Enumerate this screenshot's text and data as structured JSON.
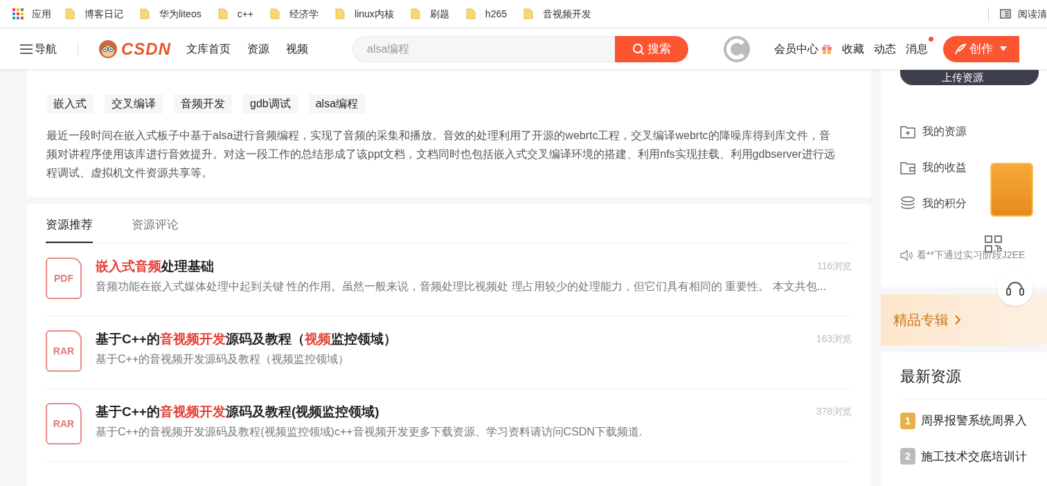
{
  "bookmarks_bar": {
    "apps_label": "应用",
    "bookmarks": [
      {
        "label": "博客日记"
      },
      {
        "label": "华为liteos"
      },
      {
        "label": "c++"
      },
      {
        "label": "经济学"
      },
      {
        "label": "linux内核"
      },
      {
        "label": "刷题"
      },
      {
        "label": "h265"
      },
      {
        "label": "音视频开发"
      }
    ],
    "reading_list": "阅读清"
  },
  "header": {
    "nav_label": "导航",
    "logo_text": "CSDN",
    "links": [
      "文库首页",
      "资源",
      "视频"
    ],
    "search": {
      "placeholder": "alsa编程",
      "button": "搜索"
    },
    "user_links": [
      {
        "label": "会员中心",
        "kind": "gift",
        "badge": false
      },
      {
        "label": "收藏",
        "kind": "plain",
        "badge": false
      },
      {
        "label": "动态",
        "kind": "plain",
        "badge": false
      },
      {
        "label": "消息",
        "kind": "plain",
        "badge": true
      }
    ],
    "create_button": "创作"
  },
  "resource_card": {
    "tags": [
      "嵌入式",
      "交叉编译",
      "音频开发",
      "gdb调试",
      "alsa编程"
    ],
    "description": "最近一段时间在嵌入式板子中基于alsa进行音频编程，实现了音频的采集和播放。音效的处理利用了开源的webrtc工程，交叉编译webrtc的降噪库得到库文件，音频对讲程序使用该库进行音效提升。对这一段工作的总结形成了该ppt文档，文档同时也包括嵌入式交叉编译环境的搭建、利用nfs实现挂载、利用gdbserver进行远程调试、虚拟机文件资源共享等。"
  },
  "tabs": [
    {
      "label": "资源推荐",
      "selected": true
    },
    {
      "label": "资源评论",
      "selected": false
    }
  ],
  "recommendations": [
    {
      "file_type": "PDF",
      "title": [
        {
          "text": "嵌入式音频",
          "highlight": true
        },
        {
          "text": "处理基础",
          "highlight": false
        }
      ],
      "summary": "音频功能在嵌入式媒体处理中起到关键 性的作用。虽然一般来说，音频处理比视频处 理占用较少的处理能力，但它们具有相同的 重要性。 本文共包...",
      "views": "116浏览"
    },
    {
      "file_type": "RAR",
      "title": [
        {
          "text": "基于C++的",
          "highlight": false
        },
        {
          "text": "音视频开发",
          "highlight": true
        },
        {
          "text": "源码及教程（",
          "highlight": false
        },
        {
          "text": "视频",
          "highlight": true
        },
        {
          "text": "监控领域）",
          "highlight": false
        }
      ],
      "summary": "基于C++的音视频开发源码及教程（视频监控领域）",
      "views": "163浏览"
    },
    {
      "file_type": "RAR",
      "title": [
        {
          "text": "基于C++的",
          "highlight": false
        },
        {
          "text": "音视频开发",
          "highlight": true
        },
        {
          "text": "源码及教程(视频监控领域)",
          "highlight": false
        }
      ],
      "summary": "基于C++的音视频开发源码及教程(视频监控领域)c++音视频开发更多下载资源、学习资料请访问CSDN下载频道.",
      "views": "378浏览"
    }
  ],
  "sidebar": {
    "upload_button": "上传资源",
    "menu": [
      {
        "label": "我的资源",
        "kind": "folder-plus"
      },
      {
        "label": "我的收益",
        "kind": "wallet"
      },
      {
        "label": "我的积分",
        "kind": "coins"
      }
    ],
    "notice": "看**下通过实习阶段J2EE",
    "featured": "精品专辑",
    "latest": {
      "title": "最新资源",
      "items": [
        {
          "rank": "1",
          "label": "周界报警系统周界入"
        },
        {
          "rank": "2",
          "label": "施工技术交底培训计"
        }
      ]
    }
  }
}
